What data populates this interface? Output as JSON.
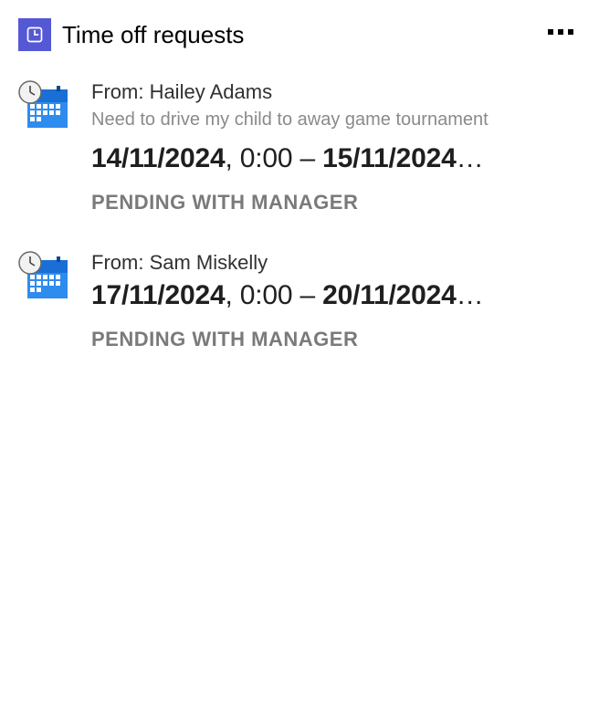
{
  "header": {
    "title": "Time off requests"
  },
  "requests": [
    {
      "from_prefix": "From: ",
      "from_name": "Hailey Adams",
      "reason": "Need to drive my child to away game tournament",
      "start_date": "14/11/2024",
      "start_time": ", 0:00",
      "separator": " – ",
      "end_date": "15/11/2024",
      "ellipsis": "…",
      "status": "PENDING WITH MANAGER"
    },
    {
      "from_prefix": "From: ",
      "from_name": "Sam Miskelly",
      "reason": "",
      "start_date": "17/11/2024",
      "start_time": ", 0:00",
      "separator": " – ",
      "end_date": "20/11/2024",
      "ellipsis": "…",
      "status": "PENDING WITH MANAGER"
    }
  ]
}
